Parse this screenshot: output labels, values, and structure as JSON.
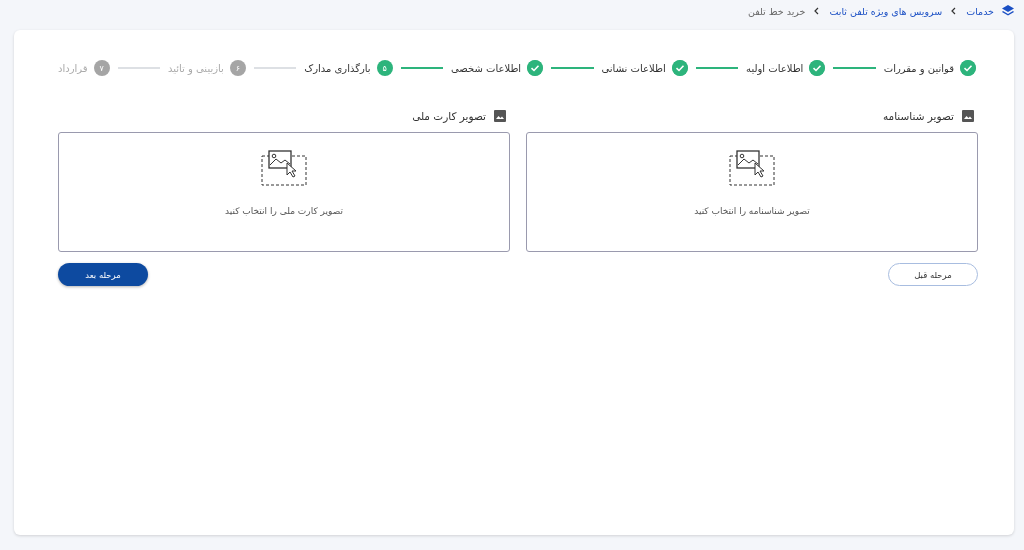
{
  "breadcrumb": [
    {
      "label": "خدمات",
      "kind": "home"
    },
    {
      "label": "سرویس های ویژه تلفن ثابت",
      "kind": "link"
    },
    {
      "label": "خرید خط تلفن",
      "kind": "current"
    }
  ],
  "steps": [
    {
      "label": "قوانین و مقررات",
      "kind": "done"
    },
    {
      "label": "اطلاعات اولیه",
      "kind": "done"
    },
    {
      "label": "اطلاعات نشانی",
      "kind": "done"
    },
    {
      "label": "اطلاعات شخصی",
      "kind": "done"
    },
    {
      "label": "بارگذاری مدارک",
      "kind": "current",
      "number": "۵"
    },
    {
      "label": "بازبینی و تائید",
      "kind": "pending",
      "number": "۶"
    },
    {
      "label": "قرارداد",
      "kind": "pending",
      "number": "۷"
    }
  ],
  "uploads": [
    {
      "title": "تصویر شناسنامه",
      "prompt": "تصویر شناسنامه را انتخاب کنید"
    },
    {
      "title": "تصویر کارت ملی",
      "prompt": "تصویر کارت ملی را انتخاب کنید"
    }
  ],
  "buttons": [
    {
      "label": "مرحله قبل",
      "kind": "outline"
    },
    {
      "label": "مرحله بعد",
      "kind": "primary"
    }
  ]
}
